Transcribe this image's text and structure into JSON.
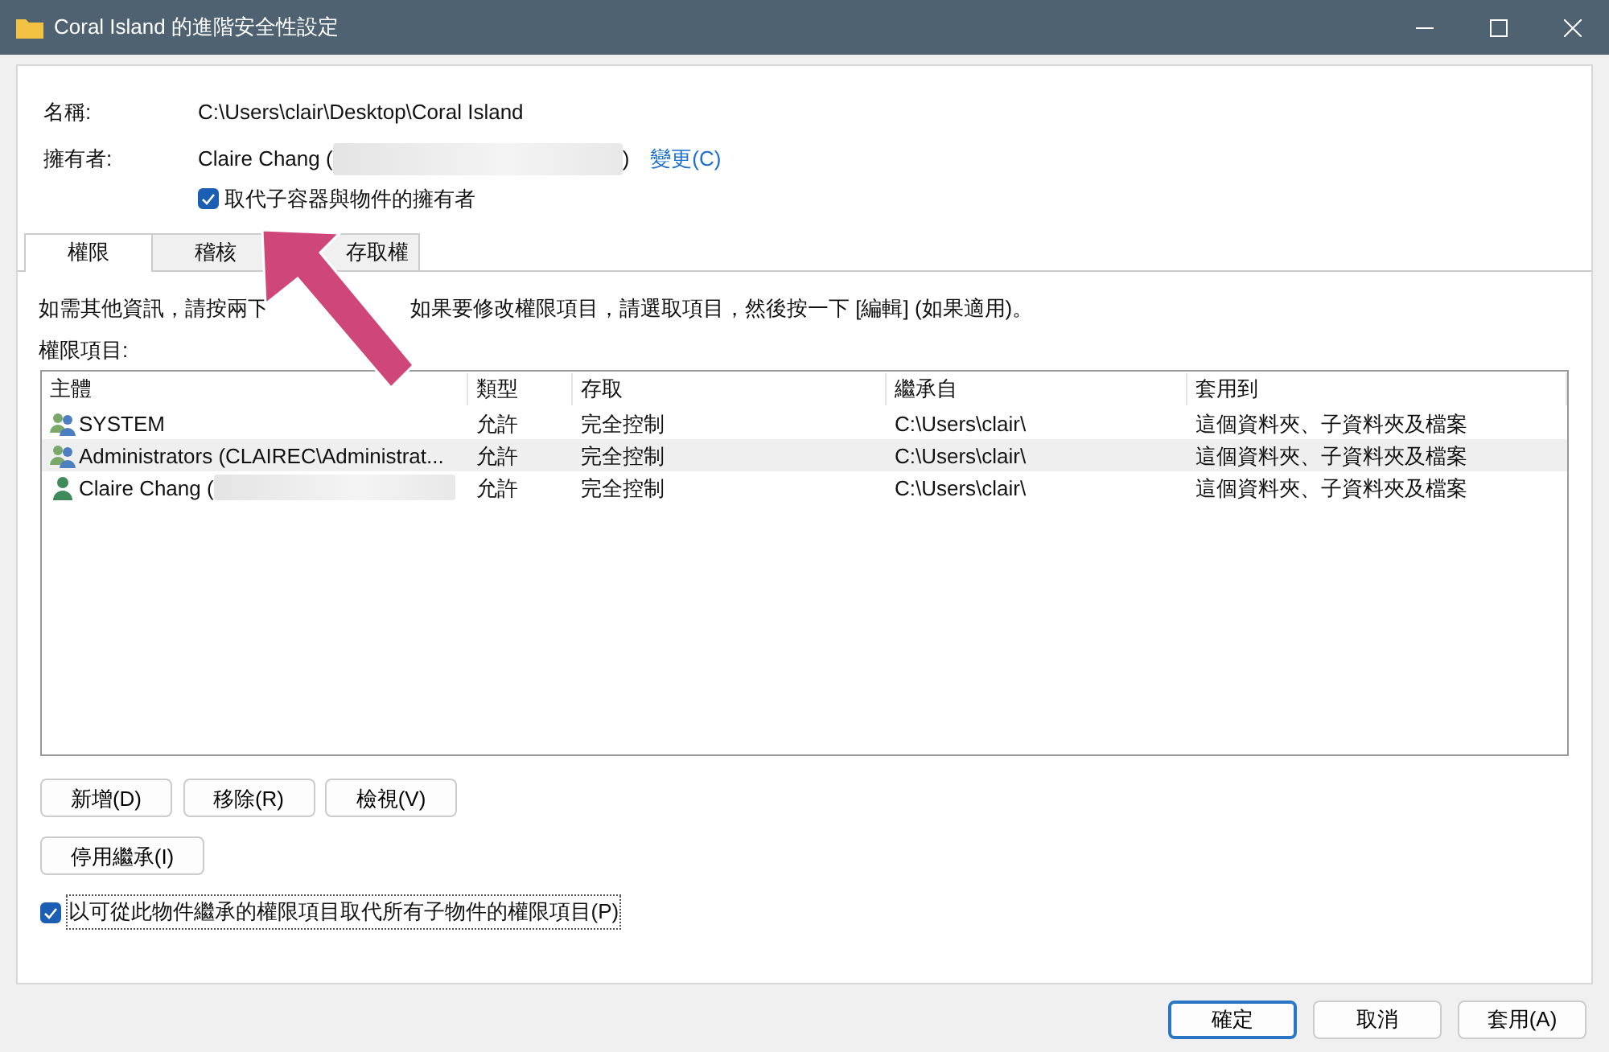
{
  "window": {
    "title": "Coral Island 的進階安全性設定"
  },
  "name_label": "名稱:",
  "name_value": "C:\\Users\\clair\\Desktop\\Coral Island",
  "owner_label": "擁有者:",
  "owner_value_start": "Claire Chang (",
  "owner_value_end": ")",
  "owner_change_link": "變更(C)",
  "replace_owner": {
    "label": "取代子容器與物件的擁有者",
    "checked": true
  },
  "tabs": [
    {
      "label": "權限",
      "selected": true
    },
    {
      "label": "稽核",
      "selected": false
    },
    {
      "label": "存取權",
      "selected": false
    }
  ],
  "instruction_parts": [
    "如需其他資訊，請按兩下",
    "如果要修改權限項目，請選取項目，然後按一下 [編輯] (如果適用)。"
  ],
  "entries_label": "權限項目:",
  "table": {
    "columns": [
      "主體",
      "類型",
      "存取",
      "繼承自",
      "套用到"
    ],
    "rows": [
      {
        "kind": "group",
        "principal": "SYSTEM",
        "redacted": false,
        "type": "允許",
        "access": "完全控制",
        "inherited_from": "C:\\Users\\clair\\",
        "applies_to": "這個資料夾、子資料夾及檔案",
        "selected": false
      },
      {
        "kind": "group",
        "principal": "Administrators (CLAIREC\\Administrat...",
        "redacted": false,
        "type": "允許",
        "access": "完全控制",
        "inherited_from": "C:\\Users\\clair\\",
        "applies_to": "這個資料夾、子資料夾及檔案",
        "selected": true
      },
      {
        "kind": "user",
        "principal": "Claire Chang (",
        "redacted": true,
        "type": "允許",
        "access": "完全控制",
        "inherited_from": "C:\\Users\\clair\\",
        "applies_to": "這個資料夾、子資料夾及檔案",
        "selected": false
      }
    ]
  },
  "action_buttons": [
    "新增(D)",
    "移除(R)",
    "檢視(V)"
  ],
  "disable_inheritance_button": "停用繼承(I)",
  "replace_child": {
    "label": "以可從此物件繼承的權限項目取代所有子物件的權限項目(P)",
    "checked": true
  },
  "footer_buttons": [
    {
      "label": "確定",
      "kind": "default"
    },
    {
      "label": "取消",
      "kind": "normal"
    },
    {
      "label": "套用(A)",
      "kind": "normal"
    }
  ]
}
